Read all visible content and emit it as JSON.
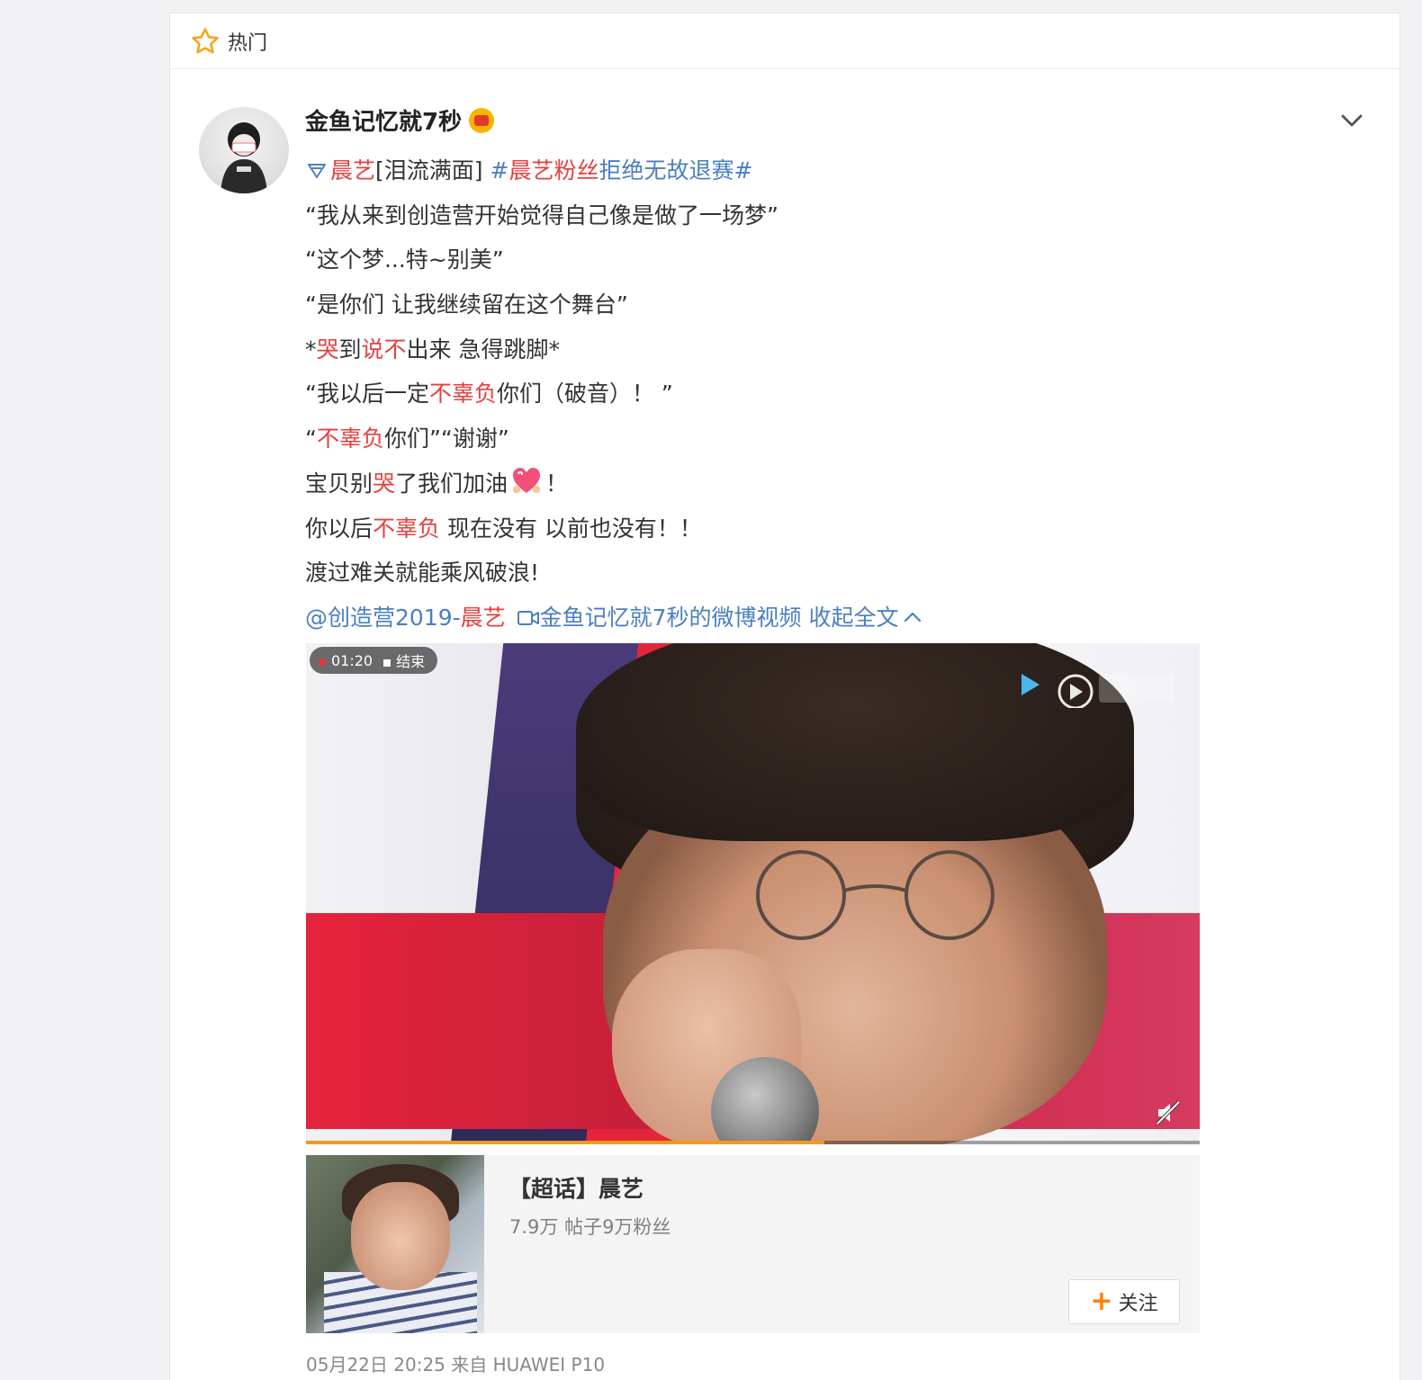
{
  "header": {
    "label": "热门"
  },
  "post": {
    "username": "金鱼记忆就7秒",
    "lines": [
      [
        "",
        "晨艺",
        "[泪流满面] ",
        "#晨艺粉丝拒绝无故退赛#"
      ],
      [
        "“我从来到创造营开始觉得自己像是做了一场梦”"
      ],
      [
        "“这个梦...特~别美”"
      ],
      [
        "“是你们 让我继续留在这个舞台”"
      ],
      [
        "*",
        "哭",
        "到",
        "说不",
        "出来 急得跳脚*"
      ],
      [
        "“我以后一定",
        "不辜负",
        "你们（破音）！ ”"
      ],
      [
        "“",
        "不辜负",
        "你们”“谢谢”"
      ],
      [
        "宝贝别",
        "哭",
        "了我们加油",
        "！"
      ],
      [
        "你以后",
        "不辜负",
        " 现在没有 以前也没有！！"
      ],
      [
        "渡过难关就能乘风破浪!"
      ]
    ],
    "footer_links": {
      "mention": "@创造营2019-",
      "mention_highlight": "晨艺",
      "video_link": "金鱼记忆就7秒的微博视频",
      "collapse": "收起全文"
    }
  },
  "video": {
    "timer": "01:20",
    "status": "结束",
    "progress": 0.58
  },
  "topic": {
    "title": "【超话】晨艺",
    "stats": "7.9万 帖子9万粉丝",
    "follow_label": "关注"
  },
  "meta": "05月22日 20:25 来自 HUAWEI P10",
  "colors": {
    "link": "#4a7fc1",
    "highlight": "#e54040",
    "accent": "#ff8200",
    "progress": "#f39a1c"
  }
}
